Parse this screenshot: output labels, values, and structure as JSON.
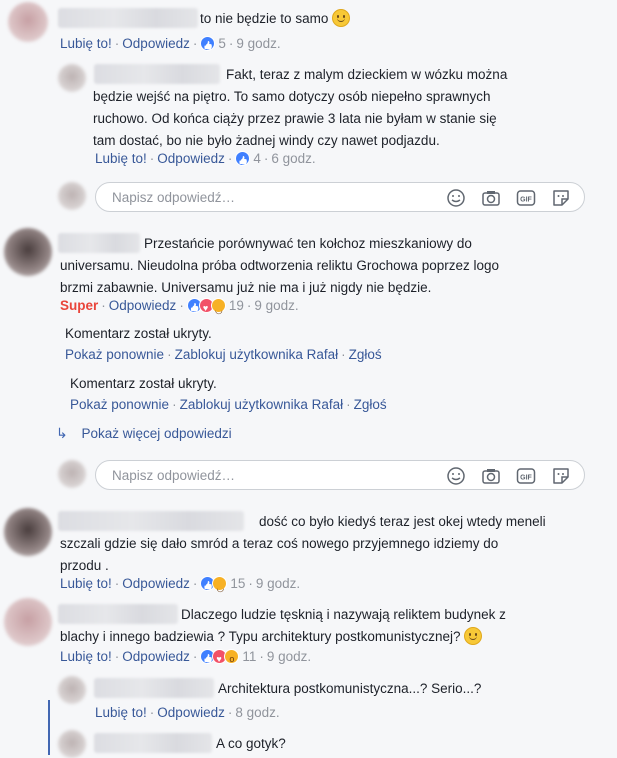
{
  "comments": [
    {
      "text_lines": [
        "to nie będzie to samo"
      ],
      "like_label": "Lubię to!",
      "reply_label": "Odpowiedz",
      "reaction_count": "5",
      "time": "9 godz."
    },
    {
      "text_lines": [
        "Fakt, teraz z malym dzieckiem w wózku można",
        "będzie wejść na piętro. To samo dotyczy osób niepełno sprawnych",
        "ruchowo. Od końca ciąży przez prawie 3 lata nie byłam w stanie się",
        "tam dostać, bo nie było żadnej windy czy nawet podjazdu."
      ],
      "like_label": "Lubię to!",
      "reply_label": "Odpowiedz",
      "reaction_count": "4",
      "time": "6 godz."
    },
    {
      "text_lines": [
        "Przestańcie porównywać ten kołchoz mieszkaniowy do",
        "universamu. Nieudolna próba odtworzenia reliktu Grochowa poprzez logo",
        "brzmi zabawnie. Universamu już nie ma i już nigdy nie będzie."
      ],
      "like_label": "Super",
      "reply_label": "Odpowiedz",
      "reaction_count": "19",
      "time": "9 godz."
    },
    {
      "text_lines": [
        "dość co było kiedyś teraz jest okej wtedy meneli",
        "szczali gdzie się dało smród a teraz coś nowego przyjemnego idziemy do",
        "przodu ."
      ],
      "like_label": "Lubię to!",
      "reply_label": "Odpowiedz",
      "reaction_count": "15",
      "time": "9 godz."
    },
    {
      "text_lines": [
        "Dlaczego ludzie tęsknią i nazywają reliktem budynek z",
        "blachy i innego badziewia ? Typu architektury postkomunistycznej?"
      ],
      "like_label": "Lubię to!",
      "reply_label": "Odpowiedz",
      "reaction_count": "11",
      "time": "9 godz."
    },
    {
      "text_lines": [
        "Architektura postkomunistyczna...? Serio...?"
      ],
      "like_label": "Lubię to!",
      "reply_label": "Odpowiedz",
      "time": "8 godz."
    },
    {
      "text_lines": [
        "A co gotyk?"
      ]
    }
  ],
  "hidden": [
    {
      "text": "Komentarz został ukryty.",
      "show_again": "Pokaż ponownie",
      "block": "Zablokuj użytkownika Rafał",
      "report": "Zgłoś"
    },
    {
      "text": "Komentarz został ukryty.",
      "show_again": "Pokaż ponownie",
      "block": "Zablokuj użytkownika Rafał",
      "report": "Zgłoś"
    }
  ],
  "show_more_replies": "Pokaż więcej odpowiedzi",
  "reply_placeholder": "Napisz odpowiedź…",
  "separator": "·",
  "colors": {
    "link": "#385898",
    "meta": "#90949c",
    "super": "#e9453b",
    "thread_line": "#4267b2",
    "background": "#f6f7f9"
  },
  "icons": [
    "smiley-icon",
    "camera-icon",
    "gif-icon",
    "sticker-icon",
    "reply-arrow-icon"
  ]
}
